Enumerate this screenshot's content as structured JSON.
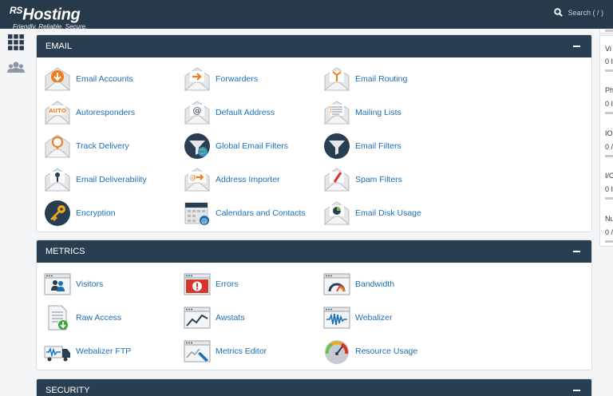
{
  "header": {
    "logo_prefix": "RS",
    "logo_main": "Hosting",
    "logo_tagline": "Friendly. Reliable. Secure.",
    "search_label": "Search ( / )"
  },
  "sidebar": {
    "items": [
      {
        "icon": "apps-grid-icon"
      },
      {
        "icon": "users-icon"
      }
    ]
  },
  "sections": {
    "email": {
      "title": "EMAIL",
      "items": [
        {
          "label": "Email Accounts",
          "icon": "email-accounts-icon"
        },
        {
          "label": "Forwarders",
          "icon": "forwarders-icon"
        },
        {
          "label": "Email Routing",
          "icon": "email-routing-icon"
        },
        {
          "label": "Autoresponders",
          "icon": "autoresponders-icon"
        },
        {
          "label": "Default Address",
          "icon": "default-address-icon"
        },
        {
          "label": "Mailing Lists",
          "icon": "mailing-lists-icon"
        },
        {
          "label": "Track Delivery",
          "icon": "track-delivery-icon"
        },
        {
          "label": "Global Email Filters",
          "icon": "global-email-filters-icon"
        },
        {
          "label": "Email Filters",
          "icon": "email-filters-icon"
        },
        {
          "label": "Email Deliverability",
          "icon": "email-deliverability-icon"
        },
        {
          "label": "Address Importer",
          "icon": "address-importer-icon"
        },
        {
          "label": "Spam Filters",
          "icon": "spam-filters-icon"
        },
        {
          "label": "Encryption",
          "icon": "encryption-key-icon"
        },
        {
          "label": "Calendars and Contacts",
          "icon": "calendars-contacts-icon"
        },
        {
          "label": "Email Disk Usage",
          "icon": "email-disk-usage-icon"
        }
      ]
    },
    "metrics": {
      "title": "METRICS",
      "items": [
        {
          "label": "Visitors",
          "icon": "visitors-icon"
        },
        {
          "label": "Errors",
          "icon": "errors-icon"
        },
        {
          "label": "Bandwidth",
          "icon": "bandwidth-icon"
        },
        {
          "label": "Raw Access",
          "icon": "raw-access-icon"
        },
        {
          "label": "Awstats",
          "icon": "awstats-icon"
        },
        {
          "label": "Webalizer",
          "icon": "webalizer-icon"
        },
        {
          "label": "Webalizer FTP",
          "icon": "webalizer-ftp-icon"
        },
        {
          "label": "Metrics Editor",
          "icon": "metrics-editor-icon"
        },
        {
          "label": "Resource Usage",
          "icon": "resource-usage-icon"
        }
      ]
    },
    "security": {
      "title": "SECURITY"
    }
  },
  "stats": [
    {
      "label": "Vi",
      "value": "0 I"
    },
    {
      "label": "Ph",
      "value": "0 I"
    },
    {
      "label": "IO",
      "value": "0 /"
    },
    {
      "label": "I/C",
      "value": "0 I"
    },
    {
      "label": "Nu",
      "value": "0 /"
    }
  ],
  "colors": {
    "header_bg": "#27394b",
    "panel_header_bg": "#2a3e52",
    "link": "#1d6fb5",
    "accent_orange": "#f07d1a"
  }
}
